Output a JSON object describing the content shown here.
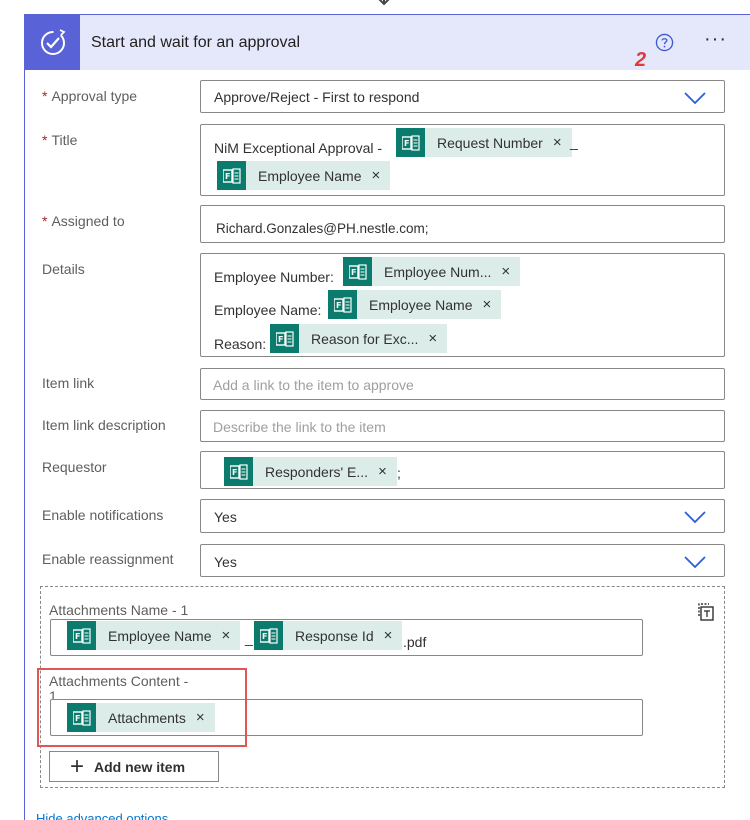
{
  "header": {
    "title": "Start and wait for an approval",
    "annotation": "2",
    "more": "···"
  },
  "fields": {
    "approval_type": {
      "label": "Approval type",
      "required": "*",
      "value": "Approve/Reject - First to respond"
    },
    "title": {
      "label": "Title",
      "required": "*",
      "prefix": "NiM Exceptional Approval -",
      "token1": "Request Number",
      "separator": "_",
      "token2": "Employee Name"
    },
    "assigned_to": {
      "label": "Assigned to",
      "required": "*",
      "value": "Richard.Gonzales@PH.nestle.com;"
    },
    "details": {
      "label": "Details",
      "line1_text": "Employee Number:",
      "line1_token": "Employee Num...",
      "line2_text": "Employee Name:",
      "line2_token": "Employee Name",
      "line3_text": "Reason:",
      "line3_token": "Reason for Exc..."
    },
    "item_link": {
      "label": "Item link",
      "placeholder": "Add a link to the item to approve"
    },
    "item_link_description": {
      "label": "Item link description",
      "placeholder": "Describe the link to the item"
    },
    "requestor": {
      "label": "Requestor",
      "token": "Responders' E...",
      "suffix": ";"
    },
    "enable_notifications": {
      "label": "Enable notifications",
      "value": "Yes"
    },
    "enable_reassignment": {
      "label": "Enable reassignment",
      "value": "Yes"
    }
  },
  "attachments": {
    "name_label": "Attachments Name - 1",
    "name_token1": "Employee Name",
    "name_separator": "_",
    "name_token2": "Response Id",
    "name_suffix": ".pdf",
    "content_label_line1": "Attachments Content -",
    "content_label_line2": "1",
    "content_token": "Attachments",
    "add_button": "Add new item"
  },
  "footer": {
    "hide_link": "Hide advanced options"
  },
  "token_close": "×",
  "colors": {
    "accent": "#5a62d8",
    "header_bg": "#e5e7fb",
    "token_bg": "#dcede9",
    "token_icon": "#0b7b6e",
    "highlight": "#e05555",
    "link": "#0078d4"
  }
}
